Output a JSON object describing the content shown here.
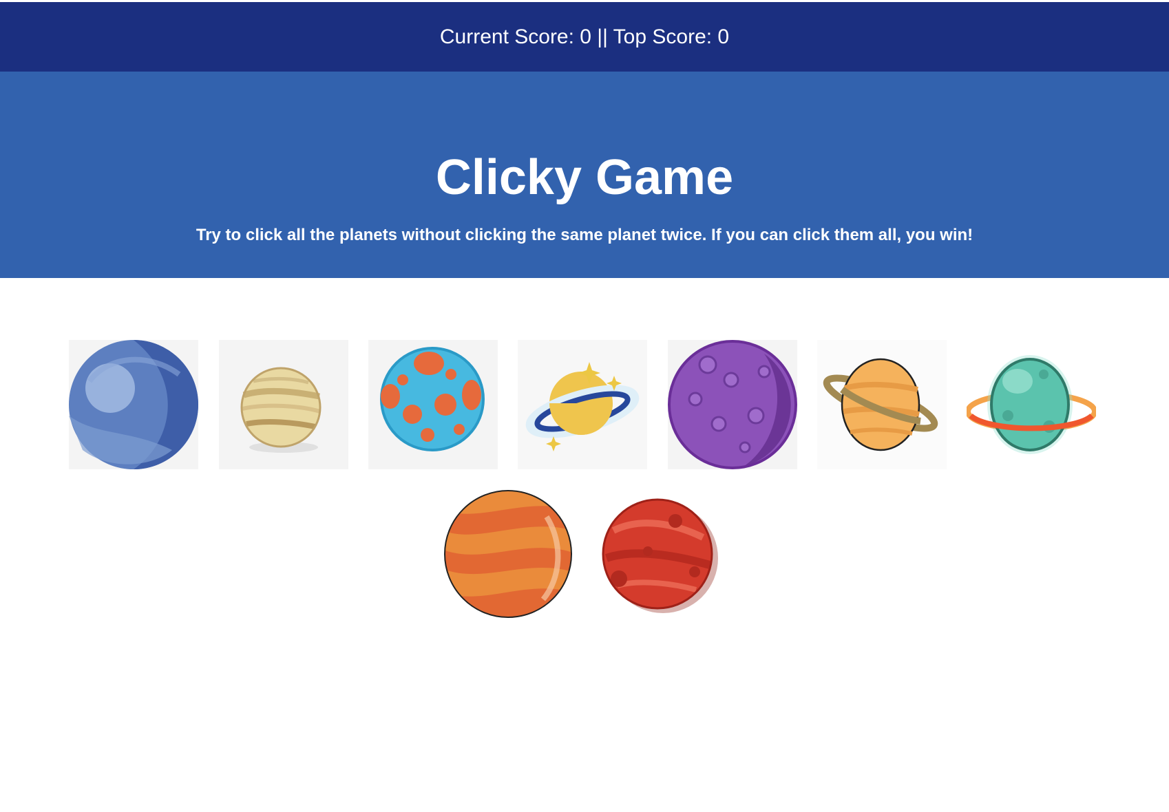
{
  "navbar": {
    "score_text": "Current Score: 0 || Top Score: 0"
  },
  "header": {
    "title": "Clicky Game",
    "subtitle": "Try to click all the planets without clicking the same planet twice. If you can click them all, you win!"
  },
  "planets": [
    {
      "name": "blue-planet-icon"
    },
    {
      "name": "cream-striped-planet-icon"
    },
    {
      "name": "cyan-crater-planet-icon"
    },
    {
      "name": "yellow-ringed-planet-icon"
    },
    {
      "name": "purple-crater-planet-icon"
    },
    {
      "name": "orange-ringed-planet-icon"
    },
    {
      "name": "teal-ringed-planet-icon"
    },
    {
      "name": "orange-striped-planet-icon"
    },
    {
      "name": "red-planet-icon"
    }
  ],
  "colors": {
    "navbar_bg": "#1b2f80",
    "header_bg": "#3262ae",
    "text": "#ffffff"
  }
}
